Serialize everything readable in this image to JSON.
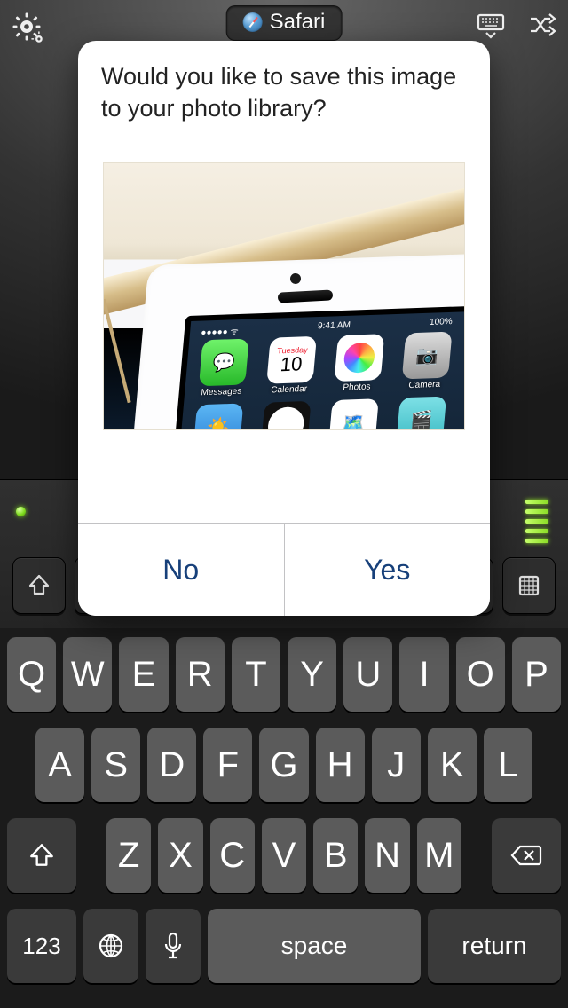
{
  "top": {
    "app_name": "Safari"
  },
  "modal": {
    "message": "Would you like to save this image to your photo library?",
    "no_label": "No",
    "yes_label": "Yes",
    "preview_status_time": "9:41 AM",
    "preview_battery": "100%",
    "calendar_day_name": "Tuesday",
    "calendar_day_num": "10",
    "app_labels": {
      "messages": "Messages",
      "calendar": "Calendar",
      "photos": "Photos",
      "camera": "Camera",
      "weather": "Weather",
      "clock": "Clock",
      "maps": "Maps",
      "videos": "Videos"
    }
  },
  "keyboard": {
    "row1": [
      "Q",
      "W",
      "E",
      "R",
      "T",
      "Y",
      "U",
      "I",
      "O",
      "P"
    ],
    "row2": [
      "A",
      "S",
      "D",
      "F",
      "G",
      "H",
      "J",
      "K",
      "L"
    ],
    "row3": [
      "Z",
      "X",
      "C",
      "V",
      "B",
      "N",
      "M"
    ],
    "k123": "123",
    "space": "space",
    "return": "return"
  }
}
